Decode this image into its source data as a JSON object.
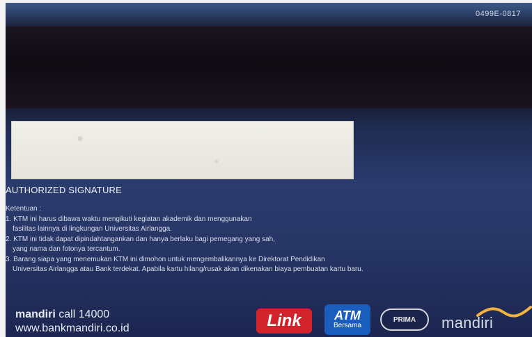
{
  "card_number": "0499E-0817",
  "signature_label": "AUTHORIZED SIGNATURE",
  "terms": {
    "heading": "Ketentuan :",
    "lines": [
      "1. KTM ini harus dibawa waktu mengikuti kegiatan akademik dan menggunakan",
      "fasilitas lainnya di lingkungan Universitas Airlangga.",
      "2. KTM ini tidak dapat dipindahtangankan dan hanya berlaku bagi pemegang yang sah,",
      "yang nama dan fotonya tercantum.",
      "3. Barang siapa yang menemukan KTM ini dimohon untuk mengembalikannya ke Direktorat Pendidikan",
      "Universitas Airlangga atau Bank terdekat. Apabila kartu hilang/rusak akan dikenakan biaya pembuatan kartu baru."
    ]
  },
  "bank": {
    "name": "mandiri",
    "call": "call 14000",
    "website": "www.bankmandiri.co.id"
  },
  "logos": {
    "link": "Link",
    "atm_top": "ATM",
    "atm_bottom": "Bersama",
    "prima": "PRIMA",
    "mandiri": "mandiri"
  },
  "colors": {
    "card_blue": "#263564",
    "stripe_dark": "#0f0b12",
    "link_red": "#d2232a",
    "atm_blue": "#1b5dbd",
    "mandiri_gold": "#f3b33d"
  }
}
